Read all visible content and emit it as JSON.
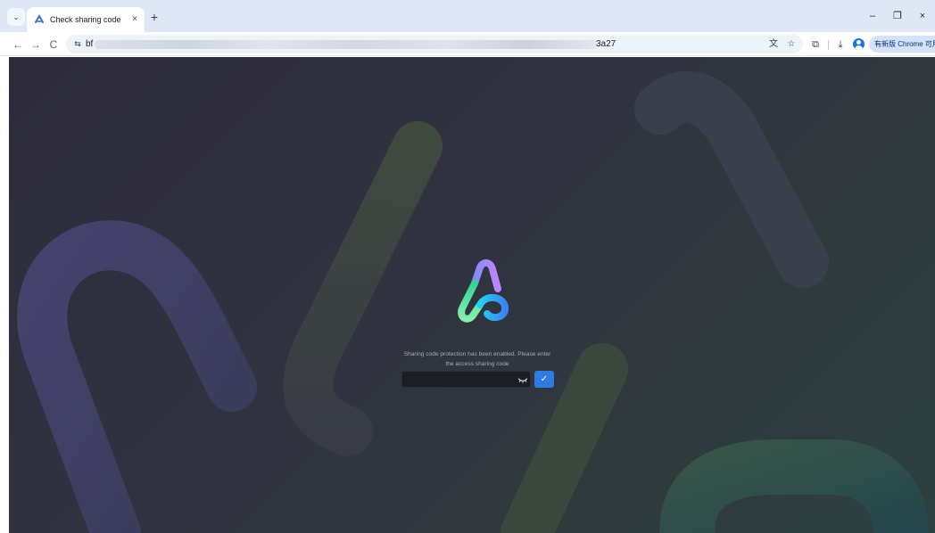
{
  "browser": {
    "tab": {
      "title": "Check sharing code",
      "close": "×"
    },
    "new_tab": "+",
    "window": {
      "minimize": "–",
      "restore": "❐",
      "close": "×"
    },
    "nav": {
      "back": "←",
      "forward": "→",
      "reload": "C"
    },
    "url": {
      "start": "bf",
      "end": "3a27"
    },
    "update_button": "有新版 Chrome 可用",
    "icons": {
      "translate": "translate-icon",
      "bookmark": "star-icon",
      "extensions": "puzzle-icon",
      "downloads": "download-icon",
      "profile": "avatar-icon"
    }
  },
  "page": {
    "prompt": "Sharing code protection has been enabled. Please enter the access sharing code",
    "code_input": {
      "value": "",
      "placeholder": ""
    },
    "submit_label": "✓",
    "colors": {
      "background": "#2f3038",
      "submit": "#2f7be5",
      "logo_purple": "#a78bfa",
      "logo_blue": "#38bdf8",
      "logo_green": "#86efac"
    }
  }
}
